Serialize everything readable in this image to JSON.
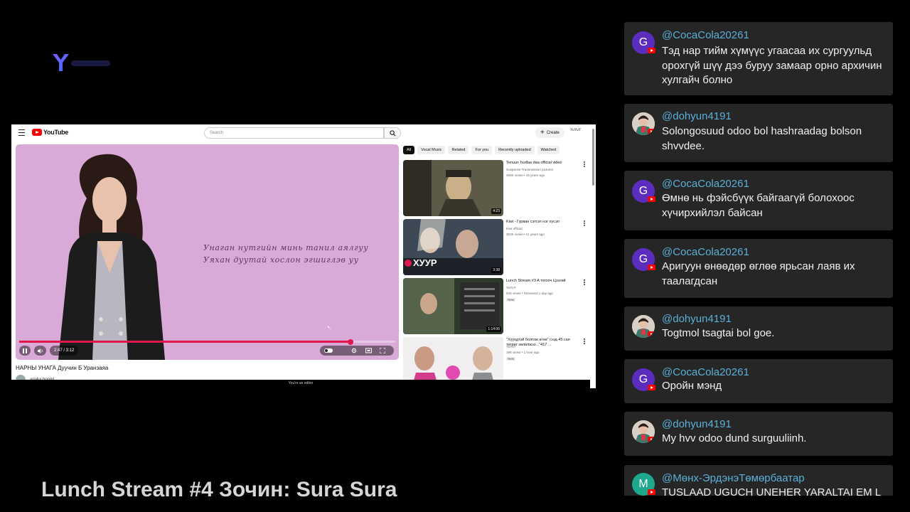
{
  "colors": {
    "background": "#000000",
    "chat_card": "#262626",
    "chat_author": "#5ab0d8",
    "youtube_red": "#ff0000",
    "player_bg": "#d9a9d8",
    "progress": "#e0174c",
    "avatar_purple": "#5b2dbf",
    "avatar_teal": "#1ea98e"
  },
  "stream": {
    "logo_icon": "yuyuy-logo-icon",
    "title": "Lunch Stream #4 Зочин: Sura Sura"
  },
  "screen": {
    "youtube": {
      "brand": "YouTube",
      "search_placeholder": "Search",
      "create_label": "Create",
      "account_label": "YuYuY"
    },
    "player": {
      "lyrics": [
        "Унаган нутгийн минь танил аялгуу",
        "Уяхан дуутай хослон эгшиглэв уу"
      ],
      "time": "2:47 / 3:12",
      "progress": 0.88
    },
    "video_title": "НАРНЫ УНАГА Дуучин Б Уранзаяа",
    "channel_name": "ariuka boogii",
    "editor_notice": "You're an editor",
    "chips": [
      "All",
      "Vocal Music",
      "Related",
      "For you",
      "Recently uploaded",
      "Watched"
    ],
    "related": [
      {
        "title": "Tenuun hudlaa daa official video",
        "channel": "Suspense Transmission pictures",
        "meta": "459K views • 15 years ago",
        "duration": "4:23",
        "badge": ""
      },
      {
        "title": "Kiwi - Гурван сэтгэл нэг хүсэл",
        "channel": "Kiwi official",
        "meta": "303K views • 11 years ago",
        "duration": "3:38",
        "badge": "",
        "overlay": "ХУУР"
      },
      {
        "title": "Lunch Stream #3 A тогооч Цээгий",
        "channel": "YuYuY",
        "meta": "544 views • Streamed 1 day ago",
        "duration": "1:14:06",
        "badge": "New"
      },
      {
        "title": "\"Хүүхдтэй болгож өгнө\" гээд 45 сая төгрөг залилжээ...\"417 ...",
        "channel": "YuYuY",
        "meta": "195 views • 1 hour ago",
        "duration": "",
        "badge": "New"
      }
    ]
  },
  "chat": {
    "messages": [
      {
        "author": "@CocaCola20261",
        "text": "Тэд нар тийм хүмүүс угаасаа их сургуульд орохгүй шүү дээ буруу замаар орно архичин хулгайч болно",
        "avatar": "G",
        "avatar_color": "#5b2dbf"
      },
      {
        "author": "@dohyun4191",
        "text": "Solongosuud odoo bol hashraadag bolson shvvdee.",
        "avatar": "",
        "avatar_color": "#d8d0c4"
      },
      {
        "author": "@CocaCola20261",
        "text": "Өмнө нь фэйсбүүк байгаагүй болохоос хүчирхийлэл байсан",
        "avatar": "G",
        "avatar_color": "#5b2dbf"
      },
      {
        "author": "@CocaCola20261",
        "text": "Аригуун өнөөдөр өглөө ярьсан лаяв их таалагдсан",
        "avatar": "G",
        "avatar_color": "#5b2dbf"
      },
      {
        "author": "@dohyun4191",
        "text": "Togtmol tsagtai bol goe.",
        "avatar": "",
        "avatar_color": "#d8d0c4"
      },
      {
        "author": "@CocaCola20261",
        "text": "Оройн мэнд",
        "avatar": "G",
        "avatar_color": "#5b2dbf"
      },
      {
        "author": "@dohyun4191",
        "text": "My hvv odoo dund surguuliinh.",
        "avatar": "",
        "avatar_color": "#d8d0c4"
      },
      {
        "author": "@Мөнх-ЭрдэнэТөмөрбаатар",
        "text": "TUSLAAD UGUCH UNEHER YARALTAI EM L",
        "avatar": "M",
        "avatar_color": "#1ea98e"
      }
    ]
  }
}
